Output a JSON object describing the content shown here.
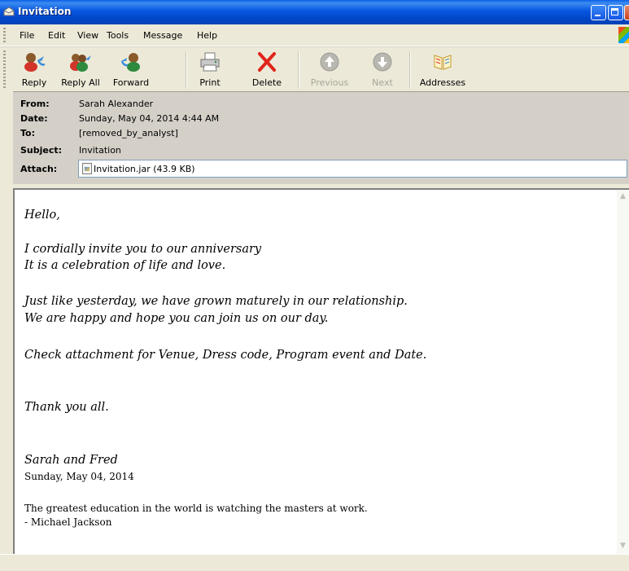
{
  "window": {
    "title": "Invitation"
  },
  "menu": [
    "File",
    "Edit",
    "View",
    "Tools",
    "Message",
    "Help"
  ],
  "toolbar": {
    "reply": "Reply",
    "reply_all": "Reply All",
    "forward": "Forward",
    "print": "Print",
    "delete": "Delete",
    "previous": "Previous",
    "next": "Next",
    "addresses": "Addresses"
  },
  "header": {
    "from_label": "From:",
    "from": "Sarah Alexander",
    "date_label": "Date:",
    "date": "Sunday, May 04, 2014 4:44 AM",
    "to_label": "To:",
    "to": "[removed_by_analyst]",
    "subject_label": "Subject:",
    "subject": "Invitation",
    "attach_label": "Attach:",
    "attachment": "Invitation.jar (43.9 KB)"
  },
  "message": {
    "greeting": "Hello,",
    "p1_line1": "I cordially invite you to our anniversary",
    "p1_line2": "It is a celebration of life and love.",
    "p2_line1": "Just like yesterday, we have grown maturely in our relationship.",
    "p2_line2": "We are happy and hope you can join us on our day.",
    "p3": "Check attachment for Venue, Dress code, Program event and Date.",
    "thanks": "Thank you all.",
    "signature": "Sarah and Fred",
    "sig_date": "Sunday, May 04, 2014",
    "quote_line1": "The greatest education in the world is watching the masters at work.",
    "quote_line2": "- Michael Jackson"
  },
  "icons": [
    "envelope-icon",
    "reply-icon",
    "reply-all-icon",
    "forward-icon",
    "print-icon",
    "delete-icon",
    "previous-icon",
    "next-icon",
    "addresses-icon",
    "attachment-icon"
  ]
}
